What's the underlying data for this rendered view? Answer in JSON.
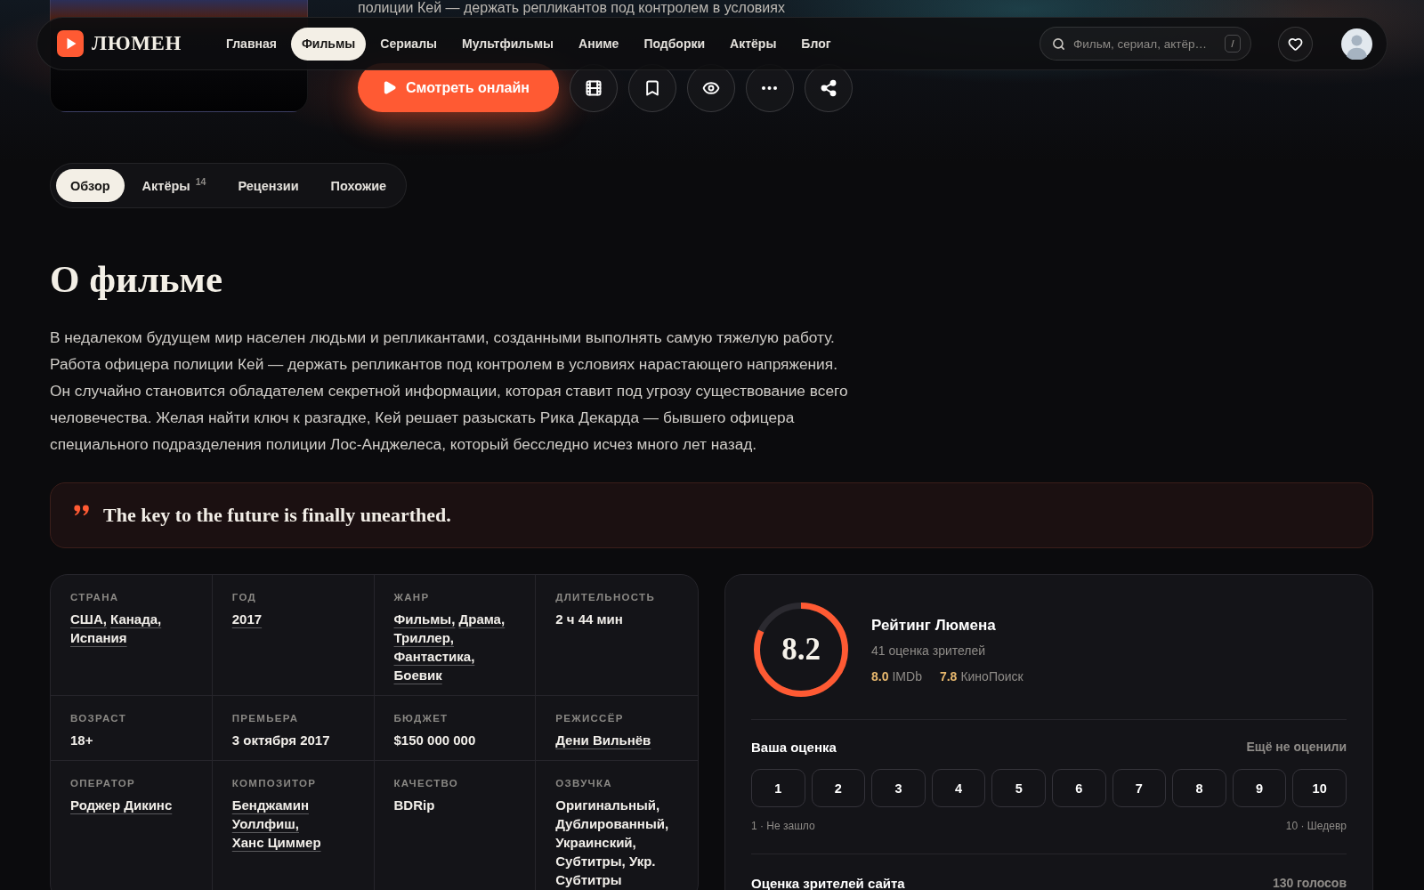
{
  "header": {
    "logo": "ЛЮМЕН",
    "nav": [
      {
        "label": "Главная",
        "selected": false
      },
      {
        "label": "Фильмы",
        "selected": true
      },
      {
        "label": "Сериалы",
        "selected": false
      },
      {
        "label": "Мультфильмы",
        "selected": false
      },
      {
        "label": "Аниме",
        "selected": false
      },
      {
        "label": "Подборки",
        "selected": false
      },
      {
        "label": "Актёры",
        "selected": false
      },
      {
        "label": "Блог",
        "selected": false
      }
    ],
    "search": {
      "placeholder": "Фильм, сериал, актёр…",
      "shortcut": "/"
    }
  },
  "hero": {
    "description_fragment": "полиции Кей — держать репликантов под контролем в условиях",
    "watch_button": "Смотреть онлайн"
  },
  "tabs": [
    {
      "label": "Обзор",
      "selected": true
    },
    {
      "label": "Актёры",
      "count": "14",
      "selected": false
    },
    {
      "label": "Рецензии",
      "selected": false
    },
    {
      "label": "Похожие",
      "selected": false
    }
  ],
  "about": {
    "title": "О фильме",
    "description": "В недалеком будущем мир населен людьми и репликантами, созданными выполнять самую тяжелую работу. Работа офицера полиции Кей — держать репликантов под контролем в условиях нарастающего напряжения. Он случайно становится обладателем секретной информации, которая ставит под угрозу существование всего человечества. Желая найти ключ к разгадке, Кей решает разыскать Рика Декарда — бывшего офицера специального подразделения полиции Лос-Анджелеса, который бесследно исчез много лет назад."
  },
  "tagline": "The key to the future is finally unearthed.",
  "details": [
    {
      "label": "СТРАНА",
      "kind": "links",
      "values": [
        "США,",
        "Канада,",
        "Испания"
      ]
    },
    {
      "label": "ГОД",
      "kind": "links",
      "values": [
        "2017"
      ]
    },
    {
      "label": "ЖАНР",
      "kind": "links",
      "values": [
        "Фильмы,",
        "Драма,",
        "Триллер,",
        "Фантастика,",
        "Боевик"
      ]
    },
    {
      "label": "ДЛИТЕЛЬНОСТЬ",
      "kind": "text",
      "value": "2 ч 44 мин"
    },
    {
      "label": "ВОЗРАСТ",
      "kind": "text",
      "value": "18+"
    },
    {
      "label": "ПРЕМЬЕРА",
      "kind": "text",
      "value": "3 октября 2017"
    },
    {
      "label": "БЮДЖЕТ",
      "kind": "text",
      "value": "$150 000 000"
    },
    {
      "label": "РЕЖИССЁР",
      "kind": "links",
      "values": [
        "Дени Вильнёв"
      ]
    },
    {
      "label": "ОПЕРАТОР",
      "kind": "links",
      "values": [
        "Роджер Дикинс"
      ]
    },
    {
      "label": "КОМПОЗИТОР",
      "kind": "links",
      "values": [
        "Бенджамин Уоллфиш,",
        "Ханс Циммер"
      ]
    },
    {
      "label": "КАЧЕСТВО",
      "kind": "text",
      "value": "BDRip"
    },
    {
      "label": "ОЗВУЧКА",
      "kind": "text",
      "value": "Оригинальный, Дублированный, Украинский, Субтитры, Укр. Субтитры"
    }
  ],
  "rating": {
    "score": "8.2",
    "level": 0.82,
    "title": "Рейтинг Люмена",
    "votes": "41 оценка зрителей",
    "external": [
      {
        "score": "8.0",
        "source": "IMDb"
      },
      {
        "score": "7.8",
        "source": "КиноПоиск"
      }
    ],
    "your_rating": {
      "title": "Ваша оценка",
      "status": "Ещё не оценили",
      "options": [
        {
          "label": "1",
          "selected": false
        },
        {
          "label": "2",
          "selected": false
        },
        {
          "label": "3",
          "selected": false
        },
        {
          "label": "4",
          "selected": false
        },
        {
          "label": "5",
          "selected": false
        },
        {
          "label": "6",
          "selected": false
        },
        {
          "label": "7",
          "selected": false
        },
        {
          "label": "8",
          "selected": false
        },
        {
          "label": "9",
          "selected": false
        },
        {
          "label": "10",
          "selected": false
        }
      ],
      "min_caption": "1 · Не зашло",
      "max_caption": "10 · Шедевр"
    },
    "site_rating": {
      "title": "Оценка зрителей сайта",
      "votes": "130 голосов"
    }
  }
}
